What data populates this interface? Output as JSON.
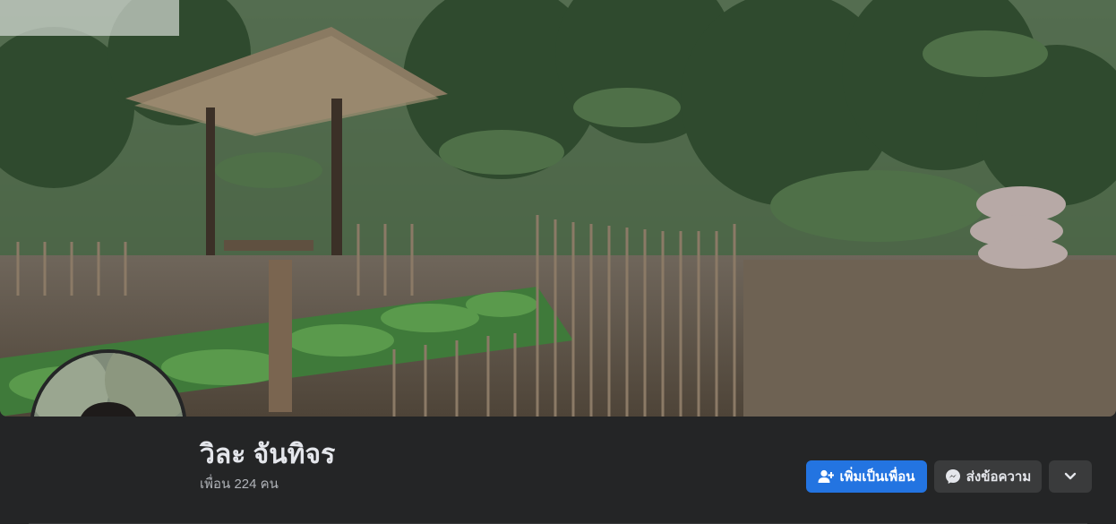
{
  "profile": {
    "name": "วิละ จันทิจร",
    "friends_text": "เพื่อน 224 คน"
  },
  "actions": {
    "add_friend_label": "เพิ่มเป็นเพื่อน",
    "message_label": "ส่งข้อความ"
  },
  "icons": {
    "add_friend": "person-add-icon",
    "message": "messenger-icon",
    "more": "chevron-down-icon"
  },
  "colors": {
    "background": "#242526",
    "primary_button": "#2374e1",
    "secondary_button": "#3a3b3c",
    "name_text": "#e4e6eb",
    "secondary_text": "#b0b3b8"
  }
}
